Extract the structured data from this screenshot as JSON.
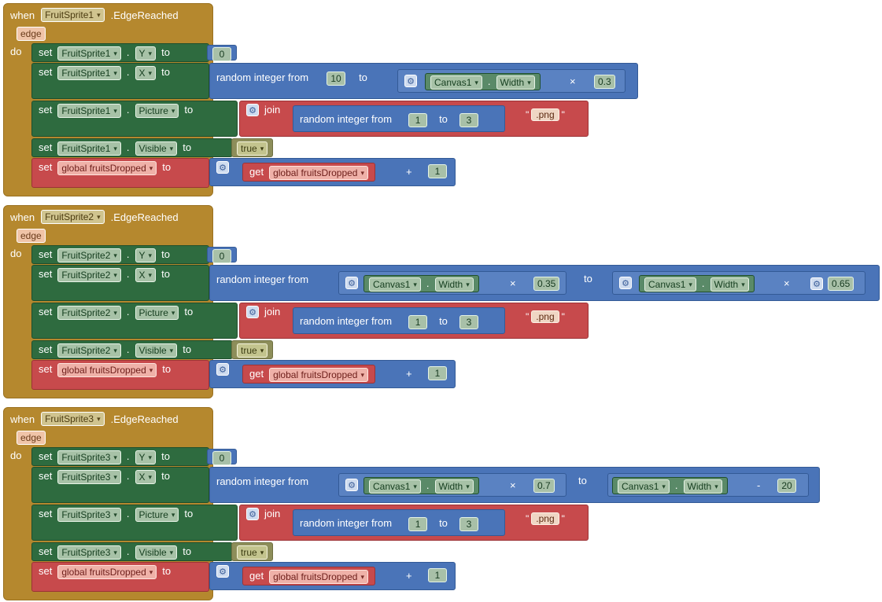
{
  "common": {
    "when": "when",
    "edge_reached": ".EdgeReached",
    "edge": "edge",
    "do": "do",
    "set": "set",
    "to": "to",
    "dot": ".",
    "random_integer_from": "random integer from",
    "join": "join",
    "times": "×",
    "minus": "-",
    "plus": "+",
    "get": "get",
    "dd_arrow": "▾",
    "global_var": "global fruitsDropped",
    "canvas": "Canvas1",
    "width": "Width",
    "prop_y": "Y",
    "prop_x": "X",
    "prop_picture": "Picture",
    "prop_visible": "Visible",
    "true_val": "true",
    "png": ".png",
    "quote": "\"",
    "one": "1",
    "three": "3",
    "zero": "0",
    "gear_icon": "⚙"
  },
  "events": [
    {
      "sprite": "FruitSprite1",
      "x_from": "10",
      "x_to_factor": "0.3"
    },
    {
      "sprite": "FruitSprite2",
      "x_from_factor": "0.35",
      "x_to_factor": "0.65"
    },
    {
      "sprite": "FruitSprite3",
      "x_from_factor": "0.7",
      "x_to_minus": "20"
    }
  ]
}
